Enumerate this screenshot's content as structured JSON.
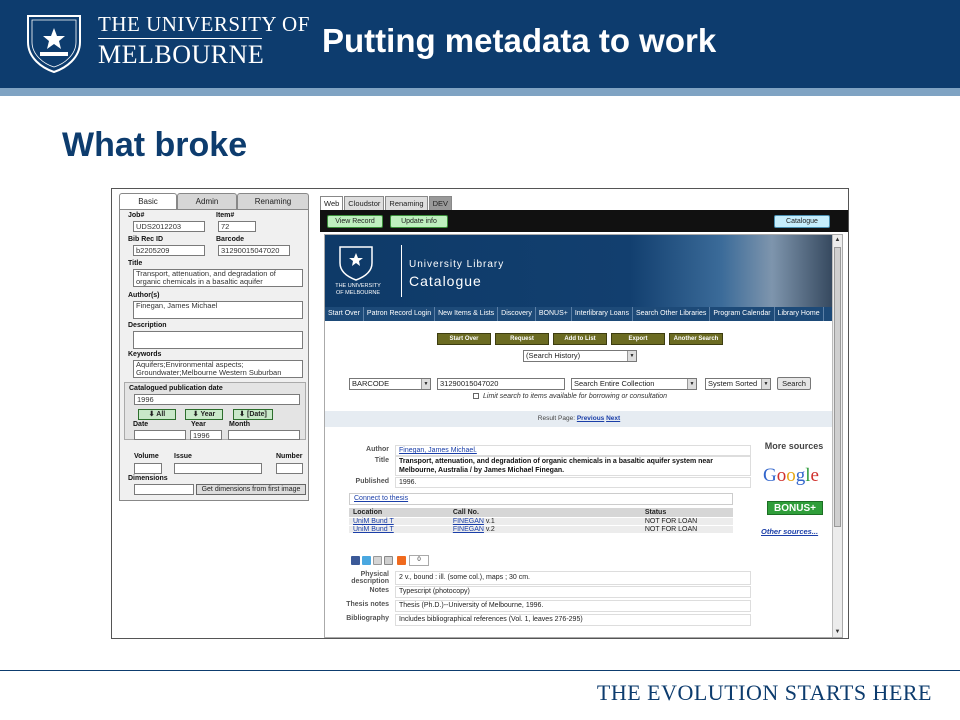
{
  "header": {
    "university_line1": "THE UNIVERSITY OF",
    "university_line2": "MELBOURNE",
    "slide_title": "Putting metadata to work",
    "colors": {
      "header_bg": "#0d3c6e",
      "stripe": "#7fa3c3"
    }
  },
  "subtitle": "What broke",
  "form": {
    "tabs": [
      "Basic",
      "Admin",
      "Renaming"
    ],
    "job_label": "Job#",
    "job_value": "UDS2012203",
    "item_label": "Item#",
    "item_value": "72",
    "bib_label": "Bib Rec ID",
    "bib_value": "b2205209",
    "barcode_label": "Barcode",
    "barcode_value": "31290015047020",
    "title_label": "Title",
    "title_value": "Transport, attenuation, and degradation of organic chemicals in a basaltic aquifer",
    "author_label": "Author(s)",
    "author_value": "Finegan, James Michael",
    "description_label": "Description",
    "description_value": "",
    "keywords_label": "Keywords",
    "keywords_value": "Aquifers;Environmental aspects; Groundwater;Melbourne Western Suburban",
    "catalogued_label": "Catalogued publication date",
    "catalogued_value": "1996",
    "btn_all": "All",
    "btn_year": "Year",
    "btn_date": "[Date]",
    "date_label": "Date",
    "year_label": "Year",
    "month_label": "Month",
    "year_value": "1996",
    "volume_label": "Volume",
    "issue_label": "Issue",
    "number_label": "Number",
    "dimensions_label": "Dimensions",
    "dimensions_button": "Get dimensions from first image"
  },
  "browser": {
    "tabs": [
      "Web",
      "Cloudstor",
      "Renaming",
      "DEV"
    ],
    "view_record": "View Record",
    "update_info": "Update info",
    "catalogue_btn": "Catalogue",
    "banner_uni": "THE UNIVERSITY OF MELBOURNE",
    "banner_line1": "University Library",
    "banner_line2": "Catalogue",
    "nav": [
      "Start Over",
      "Patron Record Login",
      "New Items & Lists",
      "Discovery",
      "BONUS+",
      "Interlibrary Loans",
      "Search Other Libraries",
      "Program Calendar",
      "Library Home"
    ],
    "action_buttons": [
      "Start Over",
      "Request",
      "Add to List",
      "Export",
      "Another Search"
    ],
    "search_history": "(Search History)",
    "search_type": "BARCODE",
    "search_value": "31290015047020",
    "search_scope": "Search Entire Collection",
    "sort": "System Sorted",
    "search_btn": "Search",
    "limit_text": "Limit search to items available for borrowing or consultation",
    "result_page_label": "Result Page:",
    "prev": "Previous",
    "next": "Next",
    "author_label": "Author",
    "author_value": "Finegan, James Michael.",
    "title_label": "Title",
    "title_value": "Transport, attenuation, and degradation of organic chemicals in a basaltic aquifer system near Melbourne, Australia / by James Michael Finegan.",
    "published_label": "Published",
    "published_value": "1996.",
    "connect": "Connect to thesis",
    "holdings_headers": [
      "Location",
      "Call No.",
      "Status"
    ],
    "holdings_rows": [
      {
        "location": "UniM Bund T",
        "callno": "FINEGAN",
        "vol": "v.1",
        "status": "NOT FOR LOAN"
      },
      {
        "location": "UniM Bund T",
        "callno": "FINEGAN",
        "vol": "v.2",
        "status": "NOT FOR LOAN"
      }
    ],
    "share_count": "0",
    "phys_label": "Physical description",
    "phys_value": "2 v., bound : ill. (some col.), maps ; 30 cm.",
    "notes_label": "Notes",
    "notes_value": "Typescript (photocopy)",
    "thesis_label": "Thesis notes",
    "thesis_value": "Thesis (Ph.D.)--University of Melbourne, 1996.",
    "biblio_label": "Bibliography",
    "biblio_value": "Includes bibliographical references (Vol. 1, leaves 276-295)",
    "more_sources": "More sources",
    "google": "Google",
    "bonus": "BONUS+",
    "other_sources": "Other sources..."
  },
  "footer": "THE EVOLUTION STARTS HERE"
}
